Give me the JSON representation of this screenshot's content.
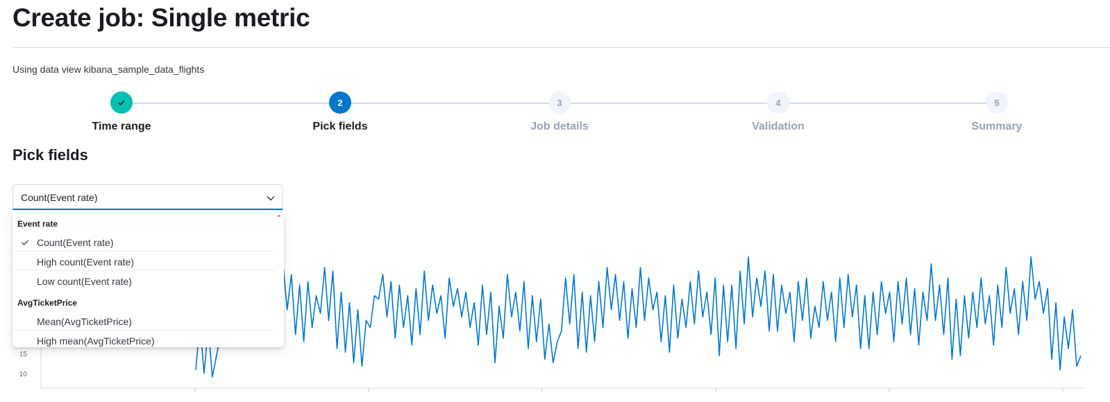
{
  "page": {
    "title": "Create job: Single metric",
    "data_view_text": "Using data view kibana_sample_data_flights"
  },
  "steps": [
    {
      "number": "",
      "title": "Time range",
      "status": "complete"
    },
    {
      "number": "2",
      "title": "Pick fields",
      "status": "current"
    },
    {
      "number": "3",
      "title": "Job details",
      "status": "incomplete"
    },
    {
      "number": "4",
      "title": "Validation",
      "status": "incomplete"
    },
    {
      "number": "5",
      "title": "Summary",
      "status": "incomplete"
    }
  ],
  "section": {
    "title": "Pick fields"
  },
  "combo": {
    "selected": "Count(Event rate)"
  },
  "dropdown": {
    "groups": [
      {
        "label": "Event rate",
        "options": [
          {
            "label": "Count(Event rate)",
            "selected": true
          },
          {
            "label": "High count(Event rate)",
            "selected": false
          },
          {
            "label": "Low count(Event rate)",
            "selected": false
          }
        ]
      },
      {
        "label": "AvgTicketPrice",
        "options": [
          {
            "label": "Mean(AvgTicketPrice)",
            "selected": false
          },
          {
            "label": "High mean(AvgTicketPrice)",
            "selected": false
          }
        ]
      }
    ]
  },
  "chart_data": {
    "type": "line",
    "series_color": "#0077cc",
    "y_ticks": [
      "15",
      "10"
    ],
    "ylim": [
      8,
      50
    ],
    "values": [
      12,
      25,
      11,
      24,
      10,
      16,
      22,
      35,
      38,
      31,
      29,
      37,
      27,
      36,
      25,
      33,
      21,
      34,
      20,
      47,
      27,
      42,
      29,
      39,
      22,
      36,
      20,
      37,
      24,
      33,
      28,
      41,
      26,
      40,
      18,
      34,
      17,
      31,
      14,
      29,
      13,
      26,
      24,
      33,
      32,
      39,
      27,
      37,
      21,
      36,
      24,
      33,
      19,
      35,
      22,
      40,
      26,
      36,
      28,
      33,
      21,
      38,
      30,
      35,
      27,
      34,
      24,
      31,
      19,
      36,
      22,
      34,
      14,
      30,
      21,
      39,
      27,
      34,
      23,
      37,
      18,
      33,
      20,
      32,
      15,
      25,
      14,
      20,
      23,
      38,
      25,
      39,
      18,
      34,
      17,
      33,
      20,
      37,
      24,
      41,
      29,
      39,
      26,
      37,
      21,
      35,
      24,
      41,
      26,
      38,
      29,
      34,
      20,
      33,
      17,
      36,
      21,
      32,
      24,
      37,
      25,
      40,
      27,
      34,
      22,
      38,
      16,
      36,
      20,
      36,
      18,
      40,
      25,
      44,
      27,
      38,
      30,
      40,
      23,
      39,
      23,
      36,
      28,
      34,
      20,
      37,
      26,
      38,
      21,
      30,
      24,
      37,
      26,
      34,
      20,
      38,
      24,
      39,
      27,
      36,
      18,
      33,
      18,
      34,
      22,
      37,
      28,
      34,
      20,
      37,
      25,
      38,
      22,
      35,
      19,
      34,
      26,
      42,
      26,
      36,
      22,
      38,
      15,
      32,
      16,
      33,
      21,
      34,
      24,
      38,
      25,
      33,
      19,
      36,
      24,
      41,
      28,
      35,
      22,
      37,
      26,
      44,
      32,
      37,
      28,
      35,
      15,
      31,
      12,
      27,
      18,
      29,
      13,
      16
    ]
  }
}
